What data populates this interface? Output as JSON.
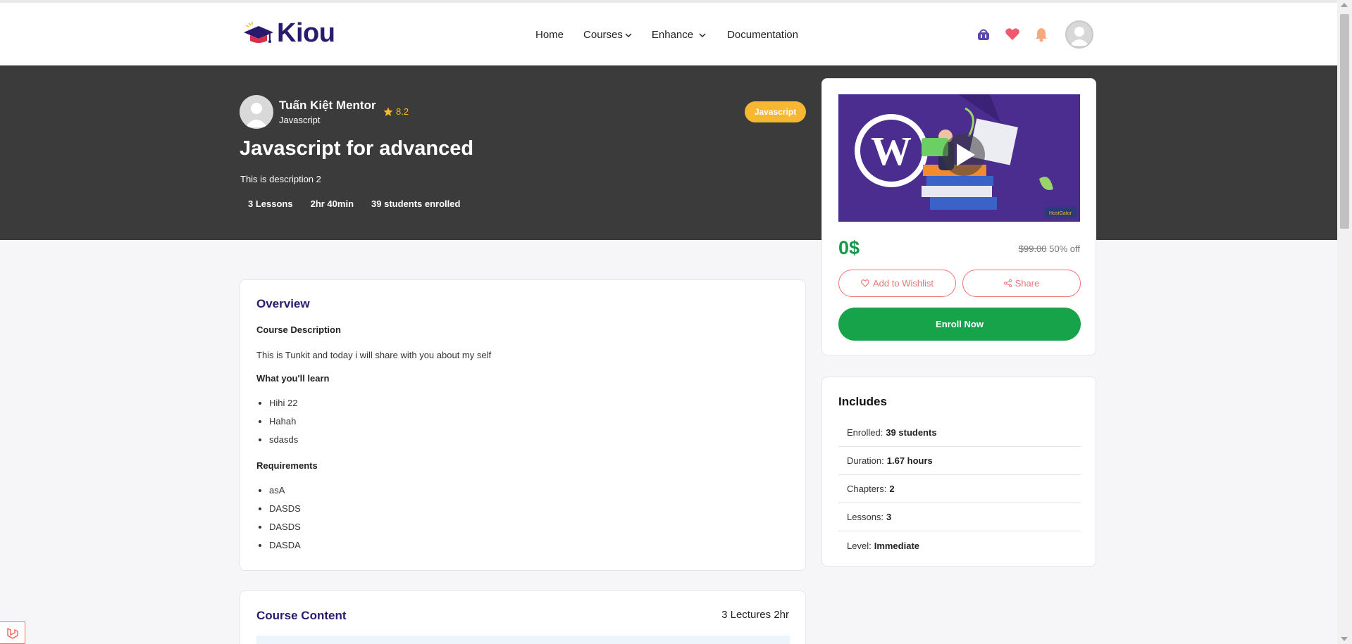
{
  "nav": {
    "logo_text": "Kiou",
    "links": [
      {
        "label": "Home"
      },
      {
        "label": "Courses"
      },
      {
        "label": "Enhance"
      },
      {
        "label": "Documentation"
      }
    ],
    "icons": [
      "basket-icon",
      "heart-icon",
      "bell-icon",
      "user-avatar"
    ]
  },
  "hero": {
    "mentor_name": "Tuấn Kiệt Mentor",
    "mentor_subtitle": "Javascript",
    "rating": "8.2",
    "category_tag": "Javascript",
    "title": "Javascript for advanced",
    "description": "This is description 2",
    "stats": [
      "3 Lessons",
      "2hr 40min",
      "39 students enrolled"
    ]
  },
  "purchase": {
    "price": "0$",
    "old_price": "$99.00",
    "discount": "50% off",
    "wishlist_label": "Add to Wishlist",
    "share_label": "Share",
    "enroll_label": "Enroll Now"
  },
  "includes": {
    "title": "Includes",
    "rows": [
      {
        "label": "Enrolled:",
        "value": "39 students"
      },
      {
        "label": "Duration:",
        "value": "1.67 hours"
      },
      {
        "label": "Chapters:",
        "value": "2"
      },
      {
        "label": "Lessons:",
        "value": "3"
      },
      {
        "label": "Level:",
        "value": "Immediate"
      }
    ]
  },
  "overview": {
    "title": "Overview",
    "course_description_heading": "Course Description",
    "course_description_text": "This is Tunkit and today i will share with you about my self",
    "learn_heading": "What you'll learn",
    "learn_items": [
      "Hihi 22",
      "Hahah",
      "sdasds"
    ],
    "requirements_heading": "Requirements",
    "requirement_items": [
      "asA",
      "DASDS",
      "DASDS",
      "DASDA"
    ]
  },
  "course_content": {
    "title": "Course Content",
    "summary": "3 Lectures 2hr"
  },
  "colors": {
    "brand": "#2a1a6e",
    "hero_bg": "#3b3b3b",
    "accent_yellow": "#f7b731",
    "enroll_green": "#17a34a",
    "price_green": "#159a4a",
    "outline_red": "#f07373"
  }
}
